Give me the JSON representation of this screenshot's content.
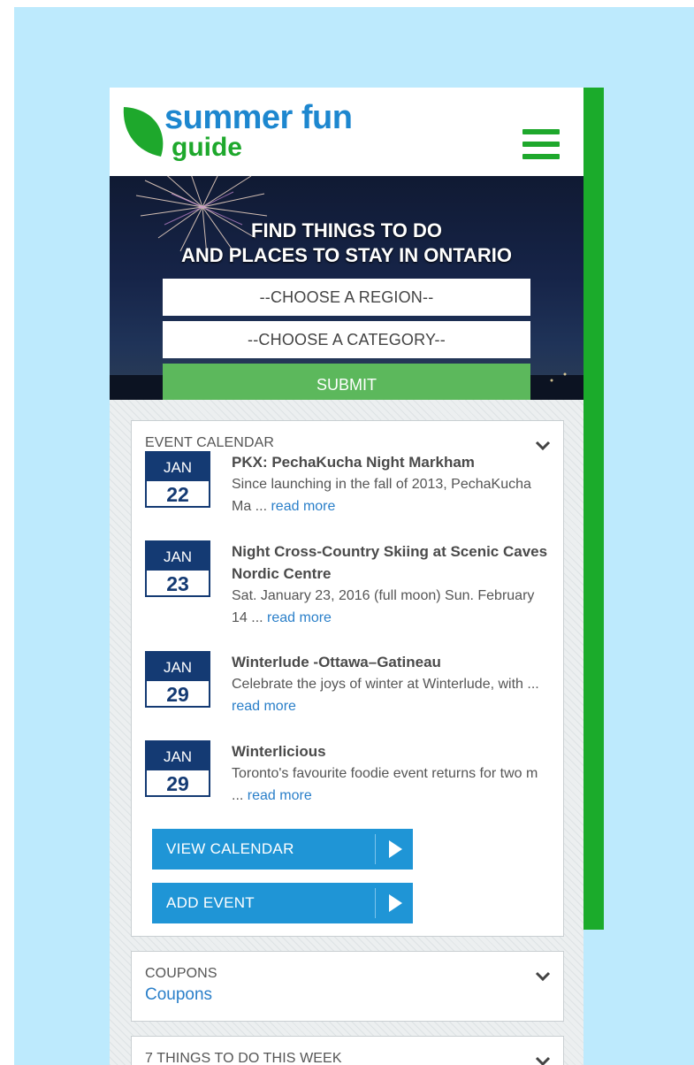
{
  "brand": {
    "line1": "summer fun",
    "line2": "guide",
    "colors": {
      "blue": "#1d87cf",
      "green": "#1ea82c"
    }
  },
  "header": {
    "menu_icon": "hamburger-menu-icon"
  },
  "hero": {
    "title_line1": "FIND THINGS TO DO",
    "title_line2": "AND PLACES TO STAY IN ONTARIO",
    "region_select": "--CHOOSE A REGION--",
    "category_select": "--CHOOSE A CATEGORY--",
    "submit_label": "SUBMIT"
  },
  "event_calendar": {
    "title": "EVENT CALENDAR",
    "events": [
      {
        "month": "JAN",
        "day": "22",
        "title": "PKX: PechaKucha Night Markham",
        "excerpt": "Since launching in the fall of 2013, PechaKucha Ma ...",
        "read_more": "read more"
      },
      {
        "month": "JAN",
        "day": "23",
        "title": "Night Cross-Country Skiing at Scenic Caves Nordic Centre",
        "excerpt": "Sat. January 23, 2016 (full moon) Sun. February 14 ...",
        "read_more": "read more"
      },
      {
        "month": "JAN",
        "day": "29",
        "title": "Winterlude -Ottawa–Gatineau",
        "excerpt": "Celebrate the joys of winter at Winterlude, with ...",
        "read_more": "read more"
      },
      {
        "month": "JAN",
        "day": "29",
        "title": "Winterlicious",
        "excerpt": "Toronto's favourite foodie event returns for two m ...",
        "read_more": "read more"
      }
    ],
    "view_calendar_label": "VIEW  CALENDAR",
    "add_event_label": "ADD EVENT"
  },
  "coupons": {
    "title": "COUPONS",
    "link": "Coupons"
  },
  "things_to_do": {
    "title": "7 THINGS TO DO THIS WEEK"
  }
}
